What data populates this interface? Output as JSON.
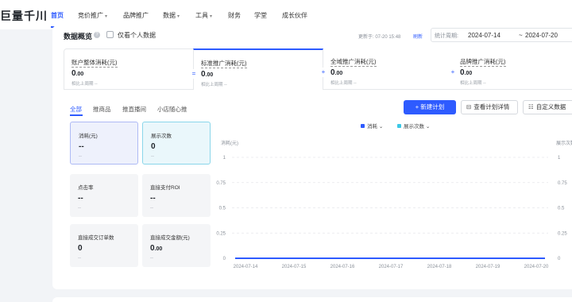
{
  "brand": {
    "logo": "巨量千川"
  },
  "nav": {
    "items": [
      {
        "label": "首页",
        "caret": false,
        "active": true
      },
      {
        "label": "竞价推广",
        "caret": true,
        "active": false
      },
      {
        "label": "品牌推广",
        "caret": false,
        "active": false
      },
      {
        "label": "数据",
        "caret": true,
        "active": false
      },
      {
        "label": "工具",
        "caret": true,
        "active": false
      },
      {
        "label": "财务",
        "caret": false,
        "active": false
      },
      {
        "label": "学堂",
        "caret": false,
        "active": false
      },
      {
        "label": "成长伙伴",
        "caret": false,
        "active": false
      }
    ]
  },
  "overview": {
    "title": "数据概览",
    "checkbox_label": "仅看个人数据",
    "updated_label": "更新于: 07-20 15:48",
    "refresh_label": "刷新",
    "period_label": "统计周期:",
    "period_start": "2024-07-14",
    "period_sep": "~",
    "period_end": "2024-07-20"
  },
  "metric_tabs": [
    {
      "title": "账户整体消耗(元)",
      "value": "0",
      "unit": ".00",
      "sub": "相比上周期 --"
    },
    {
      "title": "标准推广消耗(元)",
      "value": "0",
      "unit": ".00",
      "sub": "相比上周期 --"
    },
    {
      "title": "全域推广消耗(元)",
      "value": "0",
      "unit": ".00",
      "sub": "相比上周期 --"
    },
    {
      "title": "品牌推广消耗(元)",
      "value": "0",
      "unit": ".00",
      "sub": "相比上周期 --"
    }
  ],
  "sub_tabs": [
    "全部",
    "推商品",
    "推直播间",
    "小店随心推"
  ],
  "actions": {
    "new_plan": "+ 新建计划",
    "view_detail": "查看计划详情",
    "custom_data": "自定义数据"
  },
  "metric_boxes": [
    {
      "label": "消耗(元)",
      "value": "--",
      "unit": "",
      "sub": "--",
      "state": "selected-blue"
    },
    {
      "label": "展示次数",
      "value": "0",
      "unit": "",
      "sub": "--",
      "state": "selected-cyan"
    },
    {
      "label": "点击率",
      "value": "--",
      "unit": "",
      "sub": "--",
      "state": "normal"
    },
    {
      "label": "直接支付ROI",
      "value": "--",
      "unit": "",
      "sub": "--",
      "state": "normal"
    },
    {
      "label": "直接成交订单数",
      "value": "0",
      "unit": "",
      "sub": "--",
      "state": "normal"
    },
    {
      "label": "直接成交金额(元)",
      "value": "0",
      "unit": ".00",
      "sub": "--",
      "state": "normal"
    }
  ],
  "chart_data": {
    "type": "line",
    "x": [
      "2024-07-14",
      "2024-07-15",
      "2024-07-16",
      "2024-07-17",
      "2024-07-18",
      "2024-07-19",
      "2024-07-20"
    ],
    "series": [
      {
        "name": "消耗",
        "values": [
          0,
          0,
          0,
          0,
          0,
          0,
          0
        ],
        "color": "#2e5bff"
      },
      {
        "name": "展示次数",
        "values": [
          0,
          0,
          0,
          0,
          0,
          0,
          0
        ],
        "color": "#3cc8e6"
      }
    ],
    "ylabel_left": "消耗(元)",
    "ylabel_right": "展示次数",
    "yticks": [
      0,
      0.25,
      0.5,
      0.75,
      1
    ],
    "ylim": [
      0,
      1
    ],
    "grid": true,
    "legend_position": "top-center"
  },
  "colors": {
    "accent": "#2e5bff",
    "series2": "#3cc8e6"
  }
}
